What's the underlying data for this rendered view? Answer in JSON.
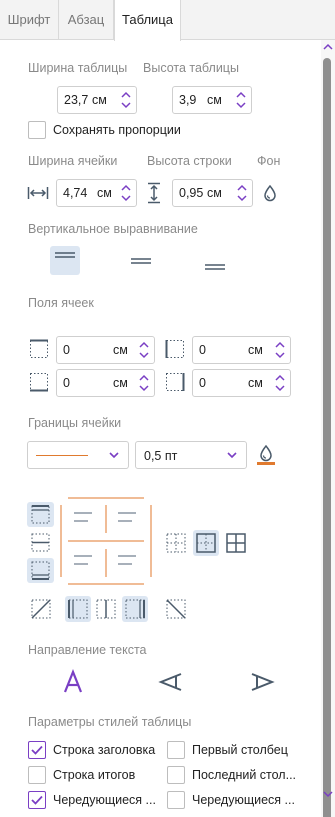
{
  "tabs": [
    {
      "label": "Шрифт",
      "active": false
    },
    {
      "label": "Абзац",
      "active": false
    },
    {
      "label": "Таблица",
      "active": true
    }
  ],
  "table_size": {
    "width_label": "Ширина таблицы",
    "height_label": "Высота таблицы",
    "width_value": "23,7",
    "width_unit": "см",
    "height_value": "3,9",
    "height_unit": "см",
    "keep_proportions_label": "Сохранять пропорции",
    "keep_proportions_checked": false
  },
  "cell_size": {
    "cell_width_label": "Ширина ячейки",
    "row_height_label": "Высота строки",
    "background_label": "Фон",
    "cell_width_value": "4,74",
    "cell_width_unit": "см",
    "row_height_value": "0,95",
    "row_height_unit": "см"
  },
  "vertical_align": {
    "label": "Вертикальное выравнивание",
    "selected": "top"
  },
  "margins": {
    "label": "Поля ячеек",
    "top": {
      "value": "0",
      "unit": "см"
    },
    "left": {
      "value": "0",
      "unit": "см"
    },
    "bottom": {
      "value": "0",
      "unit": "см"
    },
    "right": {
      "value": "0",
      "unit": "см"
    }
  },
  "borders": {
    "label": "Границы ячейки",
    "width_value": "0,5 пт",
    "color": "#e07a2e"
  },
  "text_direction": {
    "label": "Направление текста",
    "selected": "horizontal"
  },
  "style_options": {
    "label": "Параметры стилей таблицы",
    "items": [
      {
        "label": "Строка заголовка",
        "checked": true
      },
      {
        "label": "Первый столбец",
        "checked": false
      },
      {
        "label": "Строка итогов",
        "checked": false
      },
      {
        "label": "Последний стол...",
        "checked": false
      },
      {
        "label": "Чередующиеся ...",
        "checked": true
      },
      {
        "label": "Чередующиеся ...",
        "checked": false
      }
    ]
  },
  "colors": {
    "accent": "#7a3fc4",
    "border_line": "#e07a2e",
    "selected_bg": "#dce6f2",
    "icon": "#4a5a6a"
  }
}
